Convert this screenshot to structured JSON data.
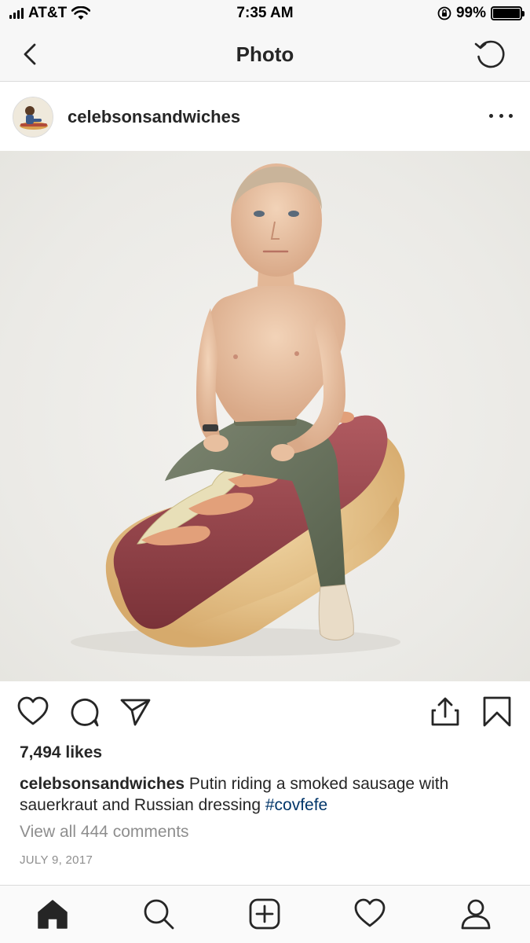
{
  "status_bar": {
    "carrier": "AT&T",
    "time": "7:35 AM",
    "battery_percent": "99%",
    "battery_level": 0.99,
    "signal_bars": 4,
    "icons": [
      "signal-icon",
      "wifi-icon",
      "rotation-lock-icon",
      "battery-icon"
    ]
  },
  "nav": {
    "title": "Photo",
    "back_icon": "chevron-left-icon",
    "refresh_icon": "refresh-icon"
  },
  "post": {
    "username": "celebsonsandwiches",
    "more_icon": "more-horizontal-icon",
    "likes": "7,494 likes",
    "caption_user": "celebsonsandwiches",
    "caption_text": " Putin riding a smoked sausage with sauerkraut and Russian dressing ",
    "hashtag": "#covfefe",
    "view_comments": "View all 444 comments",
    "date": "JULY 9, 2017",
    "actions": [
      "heart-icon",
      "comment-icon",
      "share-icon",
      "upload-icon",
      "bookmark-icon"
    ]
  },
  "tab_bar": {
    "tabs": [
      "home-icon",
      "search-icon",
      "add-post-icon",
      "activity-heart-icon",
      "profile-icon"
    ],
    "active": "home-icon"
  },
  "colors": {
    "text": "#262626",
    "secondary_text": "#8e8e8e",
    "hashtag": "#003569",
    "divider": "#dbdbdb",
    "header_bg": "#f7f7f7"
  }
}
